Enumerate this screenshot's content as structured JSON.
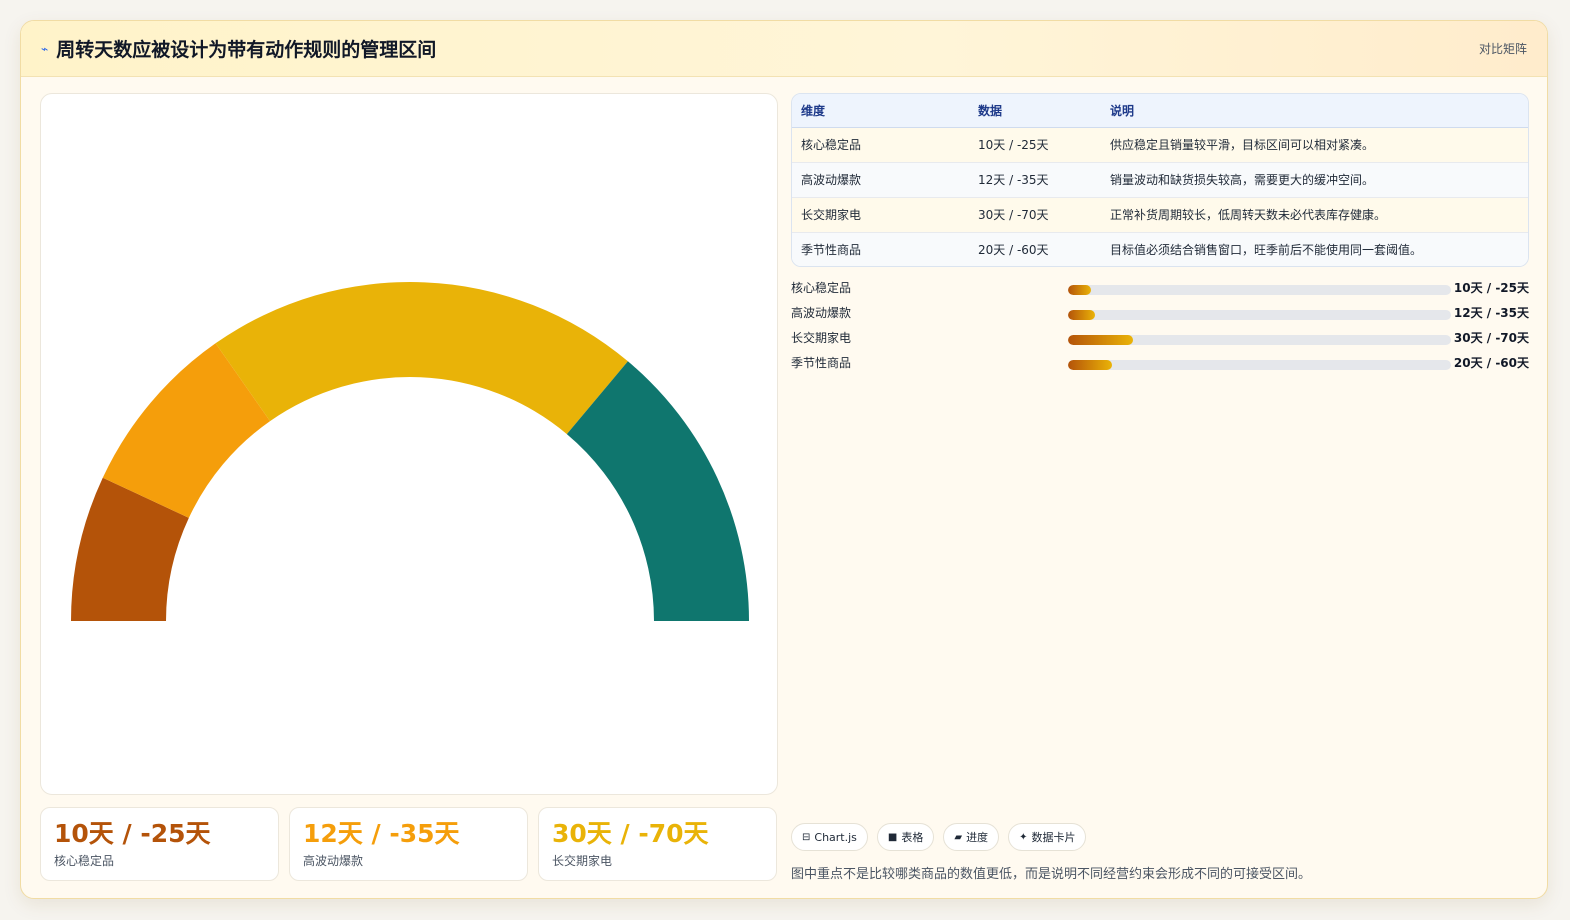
{
  "header": {
    "icon": "chart-icon",
    "title": "周转天数应被设计为带有动作规则的管理区间",
    "tag": "对比矩阵"
  },
  "colors": {
    "rust": "#b45309",
    "orange": "#f59e0b",
    "gold": "#e9b308",
    "teal": "#0f766e"
  },
  "gauge": {
    "segments": [
      {
        "category": "核心稳定品",
        "days": 10,
        "color": "#b45309"
      },
      {
        "category": "高波动爆款",
        "days": 12,
        "color": "#f59e0b"
      },
      {
        "category": "长交期家电",
        "days": 30,
        "color": "#e9b308"
      },
      {
        "category": "季节性商品",
        "days": 20,
        "color": "#0f766e"
      }
    ]
  },
  "kpis": [
    {
      "value": "10天 / -25天",
      "label": "核心稳定品",
      "color": "#b45309"
    },
    {
      "value": "12天 / -35天",
      "label": "高波动爆款",
      "color": "#f59e0b"
    },
    {
      "value": "30天 / -70天",
      "label": "长交期家电",
      "color": "#e9b308"
    }
  ],
  "table": {
    "headers": [
      "维度",
      "数据",
      "说明"
    ],
    "rows": [
      {
        "dim": "核心稳定品",
        "data": "10天 / -25天",
        "note": "供应稳定且销量较平滑，目标区间可以相对紧凑。"
      },
      {
        "dim": "高波动爆款",
        "data": "12天 / -35天",
        "note": "销量波动和缺货损失较高，需要更大的缓冲空间。"
      },
      {
        "dim": "长交期家电",
        "data": "30天 / -70天",
        "note": "正常补货周期较长，低周转天数未必代表库存健康。"
      },
      {
        "dim": "季节性商品",
        "data": "20天 / -60天",
        "note": "目标值必须结合销售窗口，旺季前后不能使用同一套阈值。"
      }
    ]
  },
  "bars": [
    {
      "label": "核心稳定品",
      "value": "10天 / -25天",
      "fraction": 0.06
    },
    {
      "label": "高波动爆款",
      "value": "12天 / -35天",
      "fraction": 0.07
    },
    {
      "label": "长交期家电",
      "value": "30天 / -70天",
      "fraction": 0.17
    },
    {
      "label": "季节性商品",
      "value": "20天 / -60天",
      "fraction": 0.115
    }
  ],
  "chips": [
    {
      "icon": "chart-icon",
      "glyph": "⊟",
      "label": "Chart.js"
    },
    {
      "icon": "table-icon",
      "glyph": "■",
      "label": "表格"
    },
    {
      "icon": "progress-icon",
      "glyph": "▰",
      "label": "进度"
    },
    {
      "icon": "card-icon",
      "glyph": "✦",
      "label": "数据卡片"
    }
  ],
  "footnote": "图中重点不是比较哪类商品的数值更低，而是说明不同经营约束会形成不同的可接受区间。"
}
